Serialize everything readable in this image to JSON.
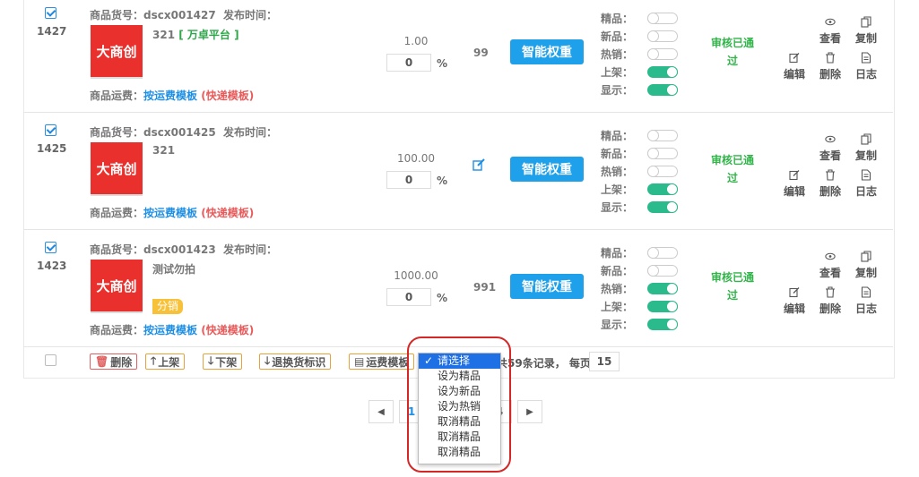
{
  "labels": {
    "sku": "商品货号：",
    "publish_time": "发布时间：",
    "shipping": "商品运费：",
    "shipping_template": "按运费模板",
    "shipping_type": "(快递模板)",
    "percent": "%",
    "weight_button": "智能权重",
    "flags": [
      "精品：",
      "新品：",
      "热销：",
      "上架：",
      "显示："
    ],
    "status": [
      "审核已通",
      "过"
    ],
    "ops": [
      "查看",
      "复制",
      "编辑",
      "删除",
      "日志"
    ],
    "thumb_text": "大商创"
  },
  "rows": [
    {
      "id": "1427",
      "checked": true,
      "sku": "dscx001427",
      "name": "321",
      "platform": "[ 万卓平台 ]",
      "tag": "",
      "price": "1.00",
      "discount": "0",
      "stock": "99",
      "stock_edit": false,
      "flags": [
        false,
        false,
        false,
        true,
        true
      ]
    },
    {
      "id": "1425",
      "checked": true,
      "sku": "dscx001425",
      "name": "321",
      "platform": "",
      "tag": "",
      "price": "100.00",
      "discount": "0",
      "stock": "",
      "stock_edit": true,
      "flags": [
        false,
        false,
        false,
        true,
        true
      ]
    },
    {
      "id": "1423",
      "checked": true,
      "sku": "dscx001423",
      "name": "测试勿拍",
      "platform": "",
      "tag": "分销",
      "price": "1000.00",
      "discount": "0",
      "stock": "991",
      "stock_edit": false,
      "flags": [
        false,
        false,
        true,
        true,
        true
      ]
    }
  ],
  "footer": {
    "delete": "删除",
    "on_shelf": "上架",
    "off_shelf": "下架",
    "return_mark": "退换货标识",
    "shipping_template": "运费模板",
    "records_text": "共59条记录，",
    "per_page_label": "每页",
    "per_page": "15"
  },
  "pager": {
    "current": "1",
    "last": "4"
  },
  "dropdown": {
    "selected": "请选择",
    "options": [
      "设为精品",
      "设为新品",
      "设为热销",
      "取消精品",
      "取消精品",
      "取消精品"
    ]
  }
}
